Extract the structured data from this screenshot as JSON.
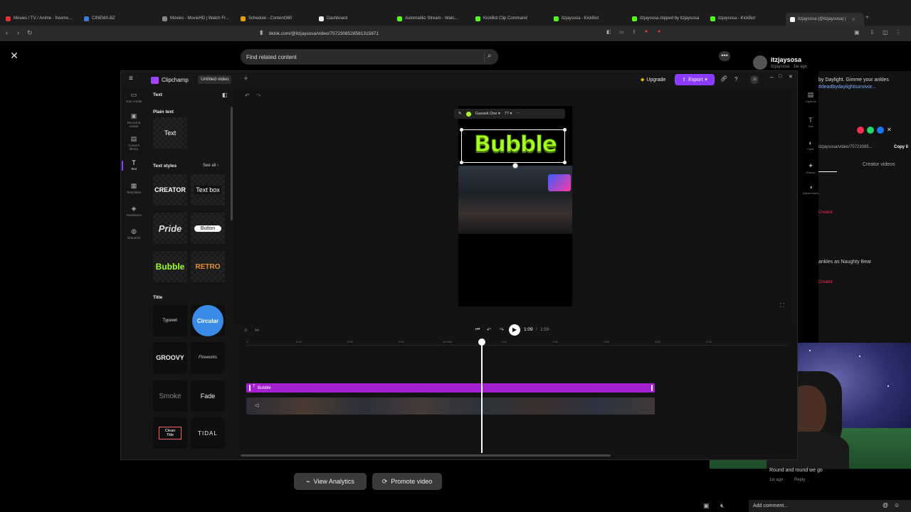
{
  "browser": {
    "tabs": [
      {
        "label": "Movies / TV / Anime - freemo...",
        "color": "#d33"
      },
      {
        "label": "CINEMA.BZ",
        "color": "#3a7bd5"
      },
      {
        "label": "Movies - MovieHD | Watch Fr...",
        "color": "#888"
      },
      {
        "label": "Schedule - Content360",
        "color": "#e6a200"
      },
      {
        "label": "Dashboard",
        "color": "#eee"
      },
      {
        "label": "Automatikz Stream - Watc...",
        "color": "#53fc18"
      },
      {
        "label": "KickBot Clip Command",
        "color": "#53fc18"
      },
      {
        "label": "itzjaysosa - KickBot",
        "color": "#53fc18"
      },
      {
        "label": "itzjaysosa clipped by itzjaysosa",
        "color": "#53fc18"
      },
      {
        "label": "itzjaysosa - KickBot",
        "color": "#53fc18"
      },
      {
        "label": "itzjaysosa (@itzjaysosa) |",
        "color": "#fff"
      }
    ],
    "url": "tiktok.com/@itzjaysosa/video/7572308528581315871"
  },
  "tiktok": {
    "search_placeholder": "Find related content",
    "username": "itzjaysosa",
    "user_sub": "itzjaysosa · 1w ago",
    "caption_a": "by Daylight. Gimme your ankles",
    "caption_b": "#deadbydaylightsurvivor...",
    "share_url": "itzjaysosa/video/75723085...",
    "copy_link": "Copy li",
    "creator_videos": "Creator videos",
    "comment_1": "ankles as Naughty Bear",
    "creator_tag": "Creator",
    "comment_last": "Round and round we go",
    "comment_meta": "1w ago",
    "reply": "Reply",
    "add_comment": "Add comment...",
    "view_analytics": "View Analytics",
    "promote_video": "Promote video"
  },
  "clipchamp": {
    "app_name": "Clipchamp",
    "project_title": "Untitled video",
    "upgrade": "Upgrade",
    "export": "Export",
    "user_initials": "JJ",
    "rail": [
      {
        "label": "Your media",
        "icon": "folder-icon"
      },
      {
        "label": "Record & create",
        "icon": "camera-icon"
      },
      {
        "label": "Content library",
        "icon": "library-icon"
      },
      {
        "label": "Text",
        "icon": "text-icon"
      },
      {
        "label": "Templates",
        "icon": "templates-icon"
      },
      {
        "label": "Transitions",
        "icon": "transitions-icon"
      },
      {
        "label": "Brand kit",
        "icon": "brand-kit-icon"
      }
    ],
    "right_rail": [
      "Captions",
      "Text",
      "Fade",
      "Effects",
      "Adjust colors"
    ],
    "panel": {
      "header": "Text",
      "plain_text_title": "Plain text",
      "plain_text_tile": "Text",
      "text_styles_title": "Text styles",
      "see_all": "See all",
      "styles": [
        "CREATOR",
        "Text box",
        "Pride",
        "Button",
        "Bubble",
        "RETRO"
      ],
      "title_section": "Title",
      "titles": [
        "Typewri",
        "Circular",
        "GROOVY",
        "Fireworks",
        "Smoke",
        "Fade",
        "Clean Title",
        "TIDAL"
      ]
    },
    "preview": {
      "font": "Gasoek One",
      "font_size": "77",
      "overlay_text": "Bubble"
    },
    "playback": {
      "current": "1:09",
      "total": "1:59",
      "separator": "/"
    },
    "timeline": {
      "ticks": [
        "0",
        "0:15",
        "0:30",
        "0:45",
        "1m 55s",
        "1:15",
        "1:30",
        "1:45",
        "2:00",
        "2:15"
      ],
      "text_clip_label": "Bubble"
    }
  }
}
